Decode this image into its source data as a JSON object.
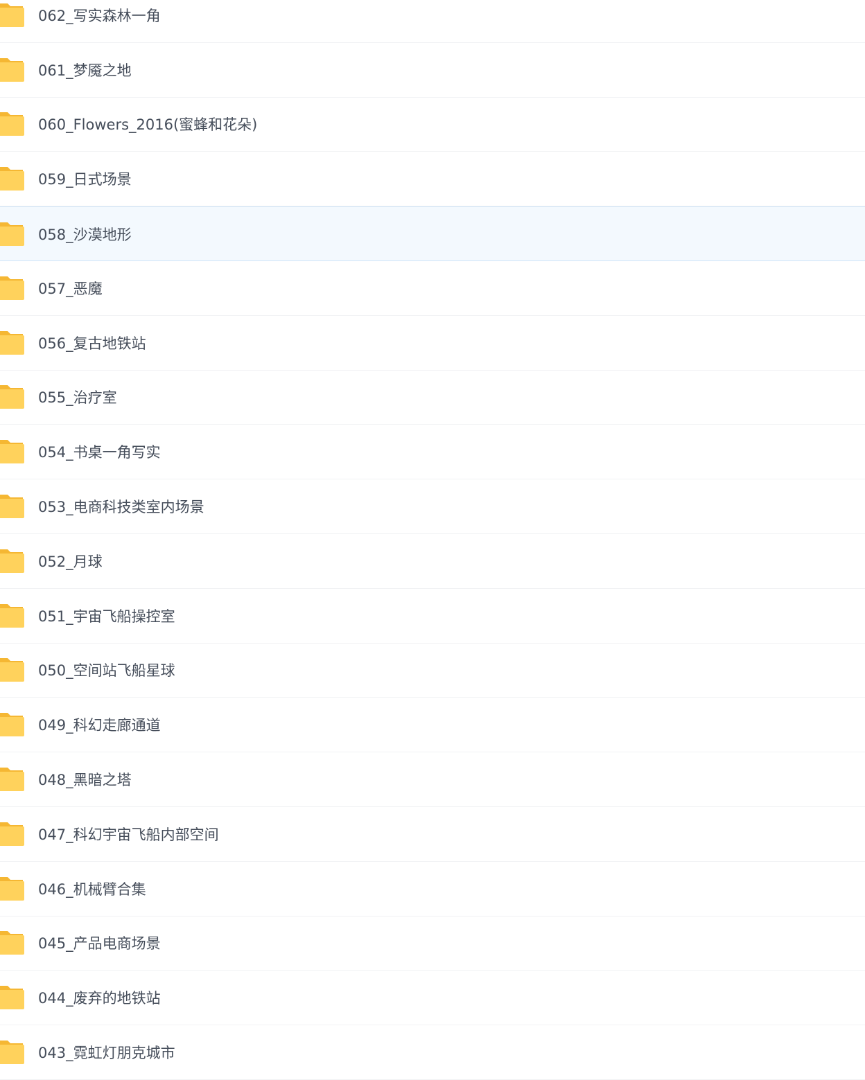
{
  "file_list": {
    "items": [
      {
        "name": "062_写实森林一角",
        "icon": "folder-icon",
        "selected": false
      },
      {
        "name": "061_梦魇之地",
        "icon": "folder-icon",
        "selected": false
      },
      {
        "name": "060_Flowers_2016(蜜蜂和花朵)",
        "icon": "folder-icon",
        "selected": false
      },
      {
        "name": "059_日式场景",
        "icon": "folder-icon",
        "selected": false
      },
      {
        "name": "058_沙漠地形",
        "icon": "folder-icon",
        "selected": true
      },
      {
        "name": "057_恶魔",
        "icon": "folder-icon",
        "selected": false
      },
      {
        "name": "056_复古地铁站",
        "icon": "folder-icon",
        "selected": false
      },
      {
        "name": "055_治疗室",
        "icon": "folder-icon",
        "selected": false
      },
      {
        "name": "054_书桌一角写实",
        "icon": "folder-icon",
        "selected": false
      },
      {
        "name": "053_电商科技类室内场景",
        "icon": "folder-icon",
        "selected": false
      },
      {
        "name": "052_月球",
        "icon": "folder-icon",
        "selected": false
      },
      {
        "name": "051_宇宙飞船操控室",
        "icon": "folder-icon",
        "selected": false
      },
      {
        "name": "050_空间站飞船星球",
        "icon": "folder-icon",
        "selected": false
      },
      {
        "name": "049_科幻走廊通道",
        "icon": "folder-icon",
        "selected": false
      },
      {
        "name": "048_黑暗之塔",
        "icon": "folder-icon",
        "selected": false
      },
      {
        "name": "047_科幻宇宙飞船内部空间",
        "icon": "folder-icon",
        "selected": false
      },
      {
        "name": "046_机械臂合集",
        "icon": "folder-icon",
        "selected": false
      },
      {
        "name": "045_产品电商场景",
        "icon": "folder-icon",
        "selected": false
      },
      {
        "name": "044_废弃的地铁站",
        "icon": "folder-icon",
        "selected": false
      },
      {
        "name": "043_霓虹灯朋克城市",
        "icon": "folder-icon",
        "selected": false
      }
    ]
  },
  "colors": {
    "folder_front": "#ffd25c",
    "folder_back": "#f5b733",
    "text": "#454d5a",
    "row_divider": "#f1f2f4",
    "selected_bg": "#f3f9fe",
    "selected_border": "#cfe5f8"
  }
}
